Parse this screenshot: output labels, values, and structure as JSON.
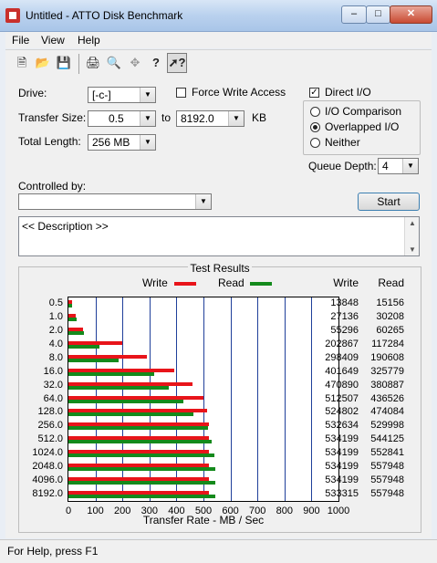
{
  "window": {
    "title": "Untitled - ATTO Disk Benchmark",
    "buttons": [
      "–",
      "□",
      "✕"
    ]
  },
  "menu": [
    "File",
    "View",
    "Help"
  ],
  "toolbar": [
    "new-icon",
    "open-icon",
    "save-icon",
    "print-icon",
    "print-preview-icon",
    "move-icon",
    "help-icon",
    "context-help-icon"
  ],
  "form": {
    "drive_label": "Drive:",
    "drive_value": "[-c-]",
    "transfer_label": "Transfer Size:",
    "transfer_from": "0.5",
    "to_label": "to",
    "transfer_to": "8192.0",
    "kb_label": "KB",
    "total_label": "Total Length:",
    "total_value": "256 MB",
    "force_write": "Force Write Access",
    "direct_io": "Direct I/O",
    "io_comparison": "I/O Comparison",
    "overlapped_io": "Overlapped I/O",
    "neither": "Neither",
    "queue_label": "Queue Depth:",
    "queue_value": "4",
    "controlled_label": "Controlled by:",
    "controlled_value": "",
    "start_label": "Start",
    "description": "<< Description >>"
  },
  "results": {
    "title": "Test Results",
    "write_legend": "Write",
    "read_legend": "Read",
    "write_header": "Write",
    "read_header": "Read"
  },
  "chart_data": {
    "type": "bar",
    "title": "Test Results",
    "xlabel": "Transfer Rate - MB / Sec",
    "xlim": [
      0,
      1000
    ],
    "xticks": [
      "0",
      "100",
      "200",
      "300",
      "400",
      "500",
      "600",
      "700",
      "800",
      "900",
      "1000"
    ],
    "categories": [
      "0.5",
      "1.0",
      "2.0",
      "4.0",
      "8.0",
      "16.0",
      "32.0",
      "64.0",
      "128.0",
      "256.0",
      "512.0",
      "1024.0",
      "2048.0",
      "4096.0",
      "8192.0"
    ],
    "series": [
      {
        "name": "Write",
        "color": "#e8141a",
        "values": [
          13848,
          27136,
          55296,
          202867,
          298409,
          401649,
          470890,
          512507,
          524802,
          532634,
          534199,
          534199,
          534199,
          534199,
          533315
        ]
      },
      {
        "name": "Read",
        "color": "#148a1c",
        "values": [
          15156,
          30208,
          60265,
          117284,
          190608,
          325779,
          380887,
          436526,
          474084,
          529998,
          544125,
          552841,
          557948,
          557948,
          557948
        ]
      }
    ]
  },
  "status": {
    "text": "For Help, press F1"
  }
}
